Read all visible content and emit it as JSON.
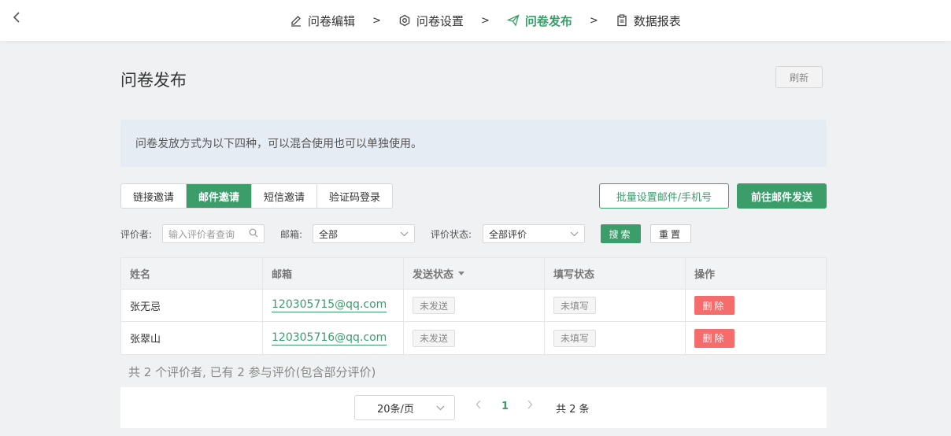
{
  "steps": [
    {
      "label": "问卷编辑",
      "icon": "pencil-icon"
    },
    {
      "label": "问卷设置",
      "icon": "gear-icon"
    },
    {
      "label": "问卷发布",
      "icon": "send-icon",
      "active": true
    },
    {
      "label": "数据报表",
      "icon": "clipboard-icon"
    }
  ],
  "step_separator": ">",
  "page": {
    "title": "问卷发布",
    "refresh_label": "刷新",
    "notice": "问卷发放方式为以下四种，可以混合使用也可以单独使用。"
  },
  "tabs": [
    {
      "label": "链接邀请"
    },
    {
      "label": "邮件邀请",
      "active": true
    },
    {
      "label": "短信邀请"
    },
    {
      "label": "验证码登录"
    }
  ],
  "actions": {
    "batch_label": "批量设置邮件/手机号",
    "send_label": "前往邮件发送"
  },
  "filters": {
    "reviewer_label": "评价者:",
    "reviewer_placeholder": "输入评价者查询",
    "email_label": "邮箱:",
    "email_value": "全部",
    "status_label": "评价状态:",
    "status_value": "全部评价",
    "search_label": "搜索",
    "reset_label": "重置"
  },
  "table": {
    "headers": [
      "姓名",
      "邮箱",
      "发送状态",
      "填写状态",
      "操作"
    ],
    "rows": [
      {
        "name": "张无忌",
        "email": "120305715@qq.com",
        "send_status": "未发送",
        "fill_status": "未填写",
        "action": "删除"
      },
      {
        "name": "张翠山",
        "email": "120305716@qq.com",
        "send_status": "未发送",
        "fill_status": "未填写",
        "action": "删除"
      }
    ]
  },
  "summary": "共 2 个评价者, 已有 2 参与评价(包含部分评价)",
  "pagination": {
    "page_size": "20条/页",
    "current_page": "1",
    "total": "共 2 条"
  },
  "colors": {
    "accent": "#3a9d6a",
    "danger": "#f56c6c"
  }
}
